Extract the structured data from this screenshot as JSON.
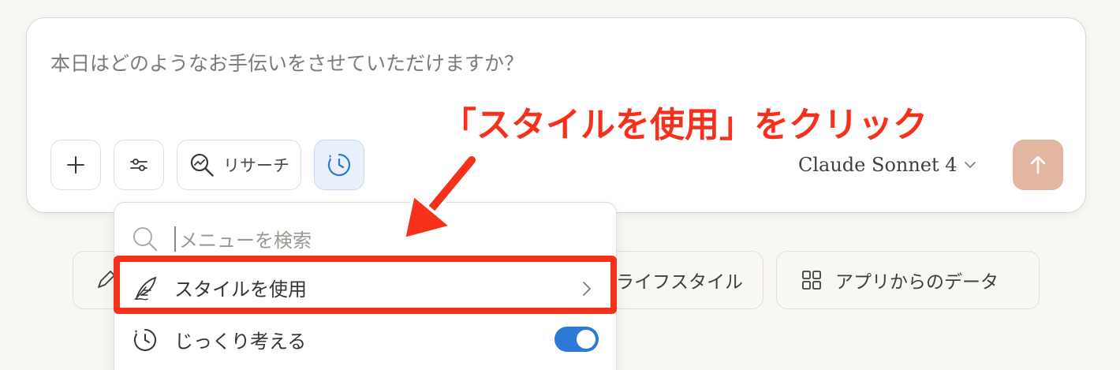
{
  "composer": {
    "placeholder": "本日はどのようなお手伝いをさせていただけますか？",
    "research_label": "リサーチ",
    "model_name": "Claude Sonnet 4"
  },
  "menu": {
    "search_placeholder": "メニューを検索",
    "items": [
      {
        "label": "スタイルを使用",
        "icon": "feather-icon",
        "has_submenu": true
      },
      {
        "label": "じっくり考える",
        "icon": "clock-icon",
        "toggle_on": true
      }
    ]
  },
  "suggestions": [
    {
      "label": "ライフスタイル"
    },
    {
      "label": "アプリからのデータ",
      "icon": "grid-icon"
    }
  ],
  "annotation": {
    "text": "「スタイルを使用」をクリック"
  },
  "colors": {
    "accent_blue": "#2c7ad6",
    "send_button": "#e3b6a2",
    "annotation_red": "#f5301b"
  }
}
